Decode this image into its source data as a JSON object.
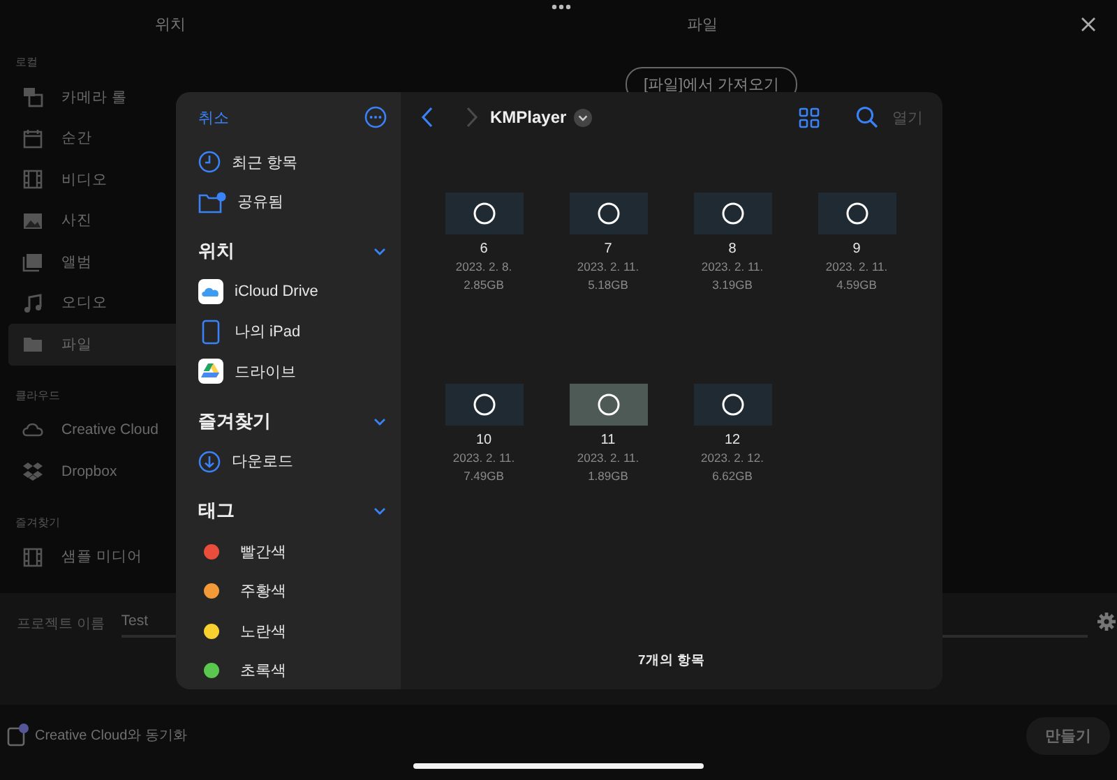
{
  "header": {
    "left_title": "위치",
    "right_title": "파일"
  },
  "sidebar": [
    {
      "label": "로컬",
      "items": [
        {
          "label": "카메라 롤",
          "selected": false
        },
        {
          "label": "순간",
          "selected": false
        },
        {
          "label": "비디오",
          "selected": false
        },
        {
          "label": "사진",
          "selected": false
        },
        {
          "label": "앨범",
          "selected": false
        },
        {
          "label": "오디오",
          "selected": false
        },
        {
          "label": "파일",
          "selected": true
        }
      ]
    },
    {
      "label": "클라우드",
      "items": [
        {
          "label": "Creative Cloud",
          "selected": false
        },
        {
          "label": "Dropbox",
          "selected": false
        }
      ]
    },
    {
      "label": "즐겨찾기",
      "items": [
        {
          "label": "샘플 미디어",
          "selected": false
        }
      ]
    }
  ],
  "import_button": "[파일]에서 가져오기",
  "project": {
    "label": "프로젝트 이름",
    "value": "Test"
  },
  "sync": {
    "label": "Creative Cloud와 동기화",
    "checked": false
  },
  "create_button": {
    "label": "만들기",
    "disabled": true
  },
  "picker": {
    "cancel": "취소",
    "top_items": [
      {
        "label": "최근 항목"
      },
      {
        "label": "공유됨"
      }
    ],
    "sections": [
      {
        "title": "위치",
        "expanded": true,
        "items": [
          {
            "label": "iCloud Drive"
          },
          {
            "label": "나의 iPad"
          },
          {
            "label": "드라이브"
          }
        ]
      },
      {
        "title": "즐겨찾기",
        "expanded": true,
        "items": [
          {
            "label": "다운로드"
          }
        ]
      },
      {
        "title": "태그",
        "expanded": true,
        "items": [
          {
            "label": "빨간색",
            "color": "#eb4d3d"
          },
          {
            "label": "주황색",
            "color": "#f19a37"
          },
          {
            "label": "노란색",
            "color": "#f7d130"
          },
          {
            "label": "초록색",
            "color": "#5ac74f"
          }
        ]
      }
    ],
    "folder": "KMPlayer",
    "open_button": {
      "label": "열기",
      "disabled": true
    },
    "files": [
      {
        "name": "6",
        "date": "2023. 2. 8.",
        "size": "2.85GB"
      },
      {
        "name": "7",
        "date": "2023. 2. 11.",
        "size": "5.18GB"
      },
      {
        "name": "8",
        "date": "2023. 2. 11.",
        "size": "3.19GB"
      },
      {
        "name": "9",
        "date": "2023. 2. 11.",
        "size": "4.59GB"
      },
      {
        "name": "10",
        "date": "2023. 2. 11.",
        "size": "7.49GB"
      },
      {
        "name": "11",
        "date": "2023. 2. 11.",
        "size": "1.89GB"
      },
      {
        "name": "12",
        "date": "2023. 2. 12.",
        "size": "6.62GB"
      }
    ],
    "item_count": "7개의 항목"
  }
}
